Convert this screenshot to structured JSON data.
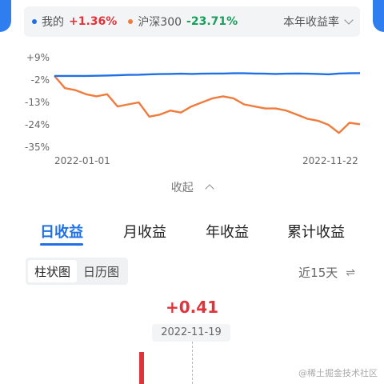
{
  "legend": {
    "items": [
      {
        "name": "我的",
        "value": "+1.36%",
        "color": "#1f6fe5",
        "value_color": "#e0343b"
      },
      {
        "name": "沪深300",
        "value": "-23.71%",
        "color": "#f07b3c",
        "value_color": "#1a9e5c"
      }
    ],
    "rate_label": "本年收益率"
  },
  "chart_data": {
    "type": "line",
    "x_start": "2022-01-01",
    "x_end": "2022-11-22",
    "y_ticks": [
      "+9%",
      "-2%",
      "-13%",
      "-24%",
      "-35%"
    ],
    "y_tick_values": [
      9,
      -2,
      -13,
      -24,
      -35
    ],
    "ylim": [
      -35,
      9
    ],
    "series": [
      {
        "name": "我的",
        "color": "#1f6fe5",
        "values": [
          0,
          0,
          0,
          0,
          0.1,
          0.2,
          0.3,
          0.5,
          0.6,
          0.8,
          0.9,
          1.0,
          1.1,
          1.0,
          1.1,
          1.2,
          1.2,
          1.3,
          1.3,
          1.2,
          1.1,
          1.0,
          1.1,
          1.2,
          1.1,
          1.0,
          0.8,
          1.2,
          1.3,
          1.36
        ]
      },
      {
        "name": "沪深300",
        "color": "#f07b3c",
        "values": [
          0,
          -6,
          -7,
          -9,
          -10,
          -9,
          -15,
          -14,
          -13,
          -20,
          -19,
          -17,
          -18,
          -15,
          -13,
          -11,
          -10,
          -11,
          -14,
          -15,
          -16,
          -16,
          -17,
          -19,
          -21,
          -22,
          -24,
          -28,
          -23,
          -23.71
        ]
      }
    ]
  },
  "collapse_label": "收起",
  "tabs": [
    "日收益",
    "月收益",
    "年收益",
    "累计收益"
  ],
  "segments": [
    "柱状图",
    "日历图"
  ],
  "range_label": "近15天",
  "range_icon": "⇌",
  "bar_value": "+0.41",
  "bar_date": "2022-11-19",
  "watermark": "@稀土掘金技术社区"
}
